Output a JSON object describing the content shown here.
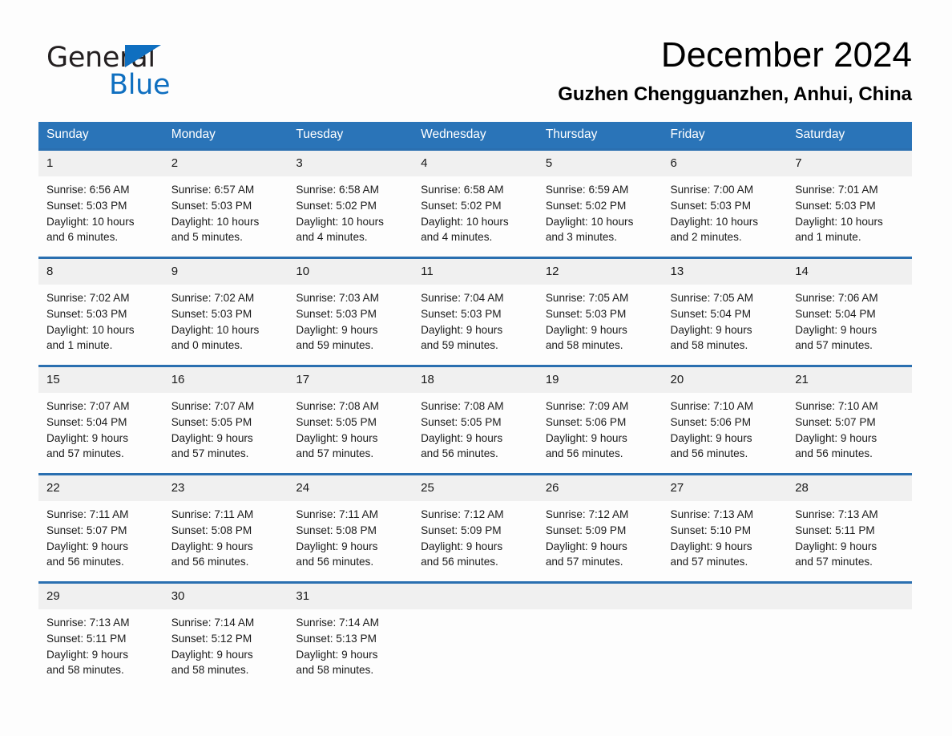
{
  "brand": {
    "name_part1": "General",
    "name_part2": "Blue",
    "logo_icon": "triangle-flag-icon",
    "accent_color": "#0f6fc0"
  },
  "header": {
    "month_title": "December 2024",
    "location": "Guzhen Chengguanzhen, Anhui, China"
  },
  "theme": {
    "header_blue": "#2a74b8",
    "row_border_blue": "#2a6fb0",
    "daynum_band": "#f0f0f0",
    "page_background": "#fdfdfd"
  },
  "calendar": {
    "weekday_headers": [
      "Sunday",
      "Monday",
      "Tuesday",
      "Wednesday",
      "Thursday",
      "Friday",
      "Saturday"
    ],
    "labels": {
      "sunrise": "Sunrise:",
      "sunset": "Sunset:",
      "daylight": "Daylight:"
    },
    "weeks": [
      [
        {
          "day": "1",
          "sunrise": "Sunrise: 6:56 AM",
          "sunset": "Sunset: 5:03 PM",
          "daylight_line1": "Daylight: 10 hours",
          "daylight_line2": "and 6 minutes."
        },
        {
          "day": "2",
          "sunrise": "Sunrise: 6:57 AM",
          "sunset": "Sunset: 5:03 PM",
          "daylight_line1": "Daylight: 10 hours",
          "daylight_line2": "and 5 minutes."
        },
        {
          "day": "3",
          "sunrise": "Sunrise: 6:58 AM",
          "sunset": "Sunset: 5:02 PM",
          "daylight_line1": "Daylight: 10 hours",
          "daylight_line2": "and 4 minutes."
        },
        {
          "day": "4",
          "sunrise": "Sunrise: 6:58 AM",
          "sunset": "Sunset: 5:02 PM",
          "daylight_line1": "Daylight: 10 hours",
          "daylight_line2": "and 4 minutes."
        },
        {
          "day": "5",
          "sunrise": "Sunrise: 6:59 AM",
          "sunset": "Sunset: 5:02 PM",
          "daylight_line1": "Daylight: 10 hours",
          "daylight_line2": "and 3 minutes."
        },
        {
          "day": "6",
          "sunrise": "Sunrise: 7:00 AM",
          "sunset": "Sunset: 5:03 PM",
          "daylight_line1": "Daylight: 10 hours",
          "daylight_line2": "and 2 minutes."
        },
        {
          "day": "7",
          "sunrise": "Sunrise: 7:01 AM",
          "sunset": "Sunset: 5:03 PM",
          "daylight_line1": "Daylight: 10 hours",
          "daylight_line2": "and 1 minute."
        }
      ],
      [
        {
          "day": "8",
          "sunrise": "Sunrise: 7:02 AM",
          "sunset": "Sunset: 5:03 PM",
          "daylight_line1": "Daylight: 10 hours",
          "daylight_line2": "and 1 minute."
        },
        {
          "day": "9",
          "sunrise": "Sunrise: 7:02 AM",
          "sunset": "Sunset: 5:03 PM",
          "daylight_line1": "Daylight: 10 hours",
          "daylight_line2": "and 0 minutes."
        },
        {
          "day": "10",
          "sunrise": "Sunrise: 7:03 AM",
          "sunset": "Sunset: 5:03 PM",
          "daylight_line1": "Daylight: 9 hours",
          "daylight_line2": "and 59 minutes."
        },
        {
          "day": "11",
          "sunrise": "Sunrise: 7:04 AM",
          "sunset": "Sunset: 5:03 PM",
          "daylight_line1": "Daylight: 9 hours",
          "daylight_line2": "and 59 minutes."
        },
        {
          "day": "12",
          "sunrise": "Sunrise: 7:05 AM",
          "sunset": "Sunset: 5:03 PM",
          "daylight_line1": "Daylight: 9 hours",
          "daylight_line2": "and 58 minutes."
        },
        {
          "day": "13",
          "sunrise": "Sunrise: 7:05 AM",
          "sunset": "Sunset: 5:04 PM",
          "daylight_line1": "Daylight: 9 hours",
          "daylight_line2": "and 58 minutes."
        },
        {
          "day": "14",
          "sunrise": "Sunrise: 7:06 AM",
          "sunset": "Sunset: 5:04 PM",
          "daylight_line1": "Daylight: 9 hours",
          "daylight_line2": "and 57 minutes."
        }
      ],
      [
        {
          "day": "15",
          "sunrise": "Sunrise: 7:07 AM",
          "sunset": "Sunset: 5:04 PM",
          "daylight_line1": "Daylight: 9 hours",
          "daylight_line2": "and 57 minutes."
        },
        {
          "day": "16",
          "sunrise": "Sunrise: 7:07 AM",
          "sunset": "Sunset: 5:05 PM",
          "daylight_line1": "Daylight: 9 hours",
          "daylight_line2": "and 57 minutes."
        },
        {
          "day": "17",
          "sunrise": "Sunrise: 7:08 AM",
          "sunset": "Sunset: 5:05 PM",
          "daylight_line1": "Daylight: 9 hours",
          "daylight_line2": "and 57 minutes."
        },
        {
          "day": "18",
          "sunrise": "Sunrise: 7:08 AM",
          "sunset": "Sunset: 5:05 PM",
          "daylight_line1": "Daylight: 9 hours",
          "daylight_line2": "and 56 minutes."
        },
        {
          "day": "19",
          "sunrise": "Sunrise: 7:09 AM",
          "sunset": "Sunset: 5:06 PM",
          "daylight_line1": "Daylight: 9 hours",
          "daylight_line2": "and 56 minutes."
        },
        {
          "day": "20",
          "sunrise": "Sunrise: 7:10 AM",
          "sunset": "Sunset: 5:06 PM",
          "daylight_line1": "Daylight: 9 hours",
          "daylight_line2": "and 56 minutes."
        },
        {
          "day": "21",
          "sunrise": "Sunrise: 7:10 AM",
          "sunset": "Sunset: 5:07 PM",
          "daylight_line1": "Daylight: 9 hours",
          "daylight_line2": "and 56 minutes."
        }
      ],
      [
        {
          "day": "22",
          "sunrise": "Sunrise: 7:11 AM",
          "sunset": "Sunset: 5:07 PM",
          "daylight_line1": "Daylight: 9 hours",
          "daylight_line2": "and 56 minutes."
        },
        {
          "day": "23",
          "sunrise": "Sunrise: 7:11 AM",
          "sunset": "Sunset: 5:08 PM",
          "daylight_line1": "Daylight: 9 hours",
          "daylight_line2": "and 56 minutes."
        },
        {
          "day": "24",
          "sunrise": "Sunrise: 7:11 AM",
          "sunset": "Sunset: 5:08 PM",
          "daylight_line1": "Daylight: 9 hours",
          "daylight_line2": "and 56 minutes."
        },
        {
          "day": "25",
          "sunrise": "Sunrise: 7:12 AM",
          "sunset": "Sunset: 5:09 PM",
          "daylight_line1": "Daylight: 9 hours",
          "daylight_line2": "and 56 minutes."
        },
        {
          "day": "26",
          "sunrise": "Sunrise: 7:12 AM",
          "sunset": "Sunset: 5:09 PM",
          "daylight_line1": "Daylight: 9 hours",
          "daylight_line2": "and 57 minutes."
        },
        {
          "day": "27",
          "sunrise": "Sunrise: 7:13 AM",
          "sunset": "Sunset: 5:10 PM",
          "daylight_line1": "Daylight: 9 hours",
          "daylight_line2": "and 57 minutes."
        },
        {
          "day": "28",
          "sunrise": "Sunrise: 7:13 AM",
          "sunset": "Sunset: 5:11 PM",
          "daylight_line1": "Daylight: 9 hours",
          "daylight_line2": "and 57 minutes."
        }
      ],
      [
        {
          "day": "29",
          "sunrise": "Sunrise: 7:13 AM",
          "sunset": "Sunset: 5:11 PM",
          "daylight_line1": "Daylight: 9 hours",
          "daylight_line2": "and 58 minutes."
        },
        {
          "day": "30",
          "sunrise": "Sunrise: 7:14 AM",
          "sunset": "Sunset: 5:12 PM",
          "daylight_line1": "Daylight: 9 hours",
          "daylight_line2": "and 58 minutes."
        },
        {
          "day": "31",
          "sunrise": "Sunrise: 7:14 AM",
          "sunset": "Sunset: 5:13 PM",
          "daylight_line1": "Daylight: 9 hours",
          "daylight_line2": "and 58 minutes."
        },
        {
          "day": "",
          "sunrise": "",
          "sunset": "",
          "daylight_line1": "",
          "daylight_line2": ""
        },
        {
          "day": "",
          "sunrise": "",
          "sunset": "",
          "daylight_line1": "",
          "daylight_line2": ""
        },
        {
          "day": "",
          "sunrise": "",
          "sunset": "",
          "daylight_line1": "",
          "daylight_line2": ""
        },
        {
          "day": "",
          "sunrise": "",
          "sunset": "",
          "daylight_line1": "",
          "daylight_line2": ""
        }
      ]
    ]
  }
}
